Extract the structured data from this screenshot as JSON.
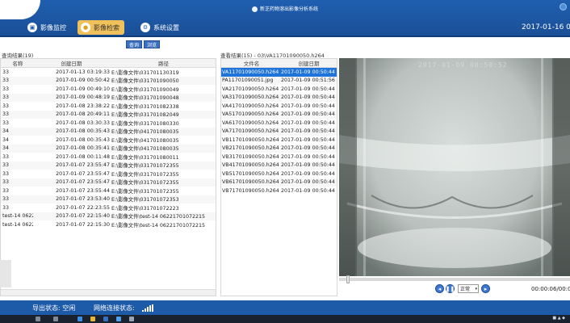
{
  "app": {
    "title": "新芝药物溶出影像分析系统",
    "datetime": "2017-01-16 0:"
  },
  "nav": {
    "tabs": [
      {
        "label": "影像监控",
        "icon": "monitor-icon"
      },
      {
        "label": "影像检索",
        "icon": "search-icon",
        "active": true
      },
      {
        "label": "系统设置",
        "icon": "gear-icon"
      }
    ]
  },
  "toolbar": {
    "query_label": "查询",
    "browse_label": "浏览"
  },
  "left_table": {
    "title": "查询结果(19)",
    "headers": [
      "名称",
      "创建日期",
      "路径"
    ],
    "rows": [
      [
        "33",
        "2017-01-13 03:19:33",
        "E:\\影像文件\\031701130319"
      ],
      [
        "33",
        "2017-01-09 00:50:42",
        "E:\\影像文件\\031701090050"
      ],
      [
        "33",
        "2017-01-09 00:49:10",
        "E:\\影像文件\\031701090049"
      ],
      [
        "33",
        "2017-01-09 00:48:19",
        "E:\\影像文件\\031701090048"
      ],
      [
        "33",
        "2017-01-08 23:38:22",
        "E:\\影像文件\\031701082338"
      ],
      [
        "33",
        "2017-01-08 20:49:11",
        "E:\\影像文件\\031701082049"
      ],
      [
        "33",
        "2017-01-08 03:30:33",
        "E:\\影像文件\\031701080330"
      ],
      [
        "34",
        "2017-01-08 00:35:43",
        "E:\\影像文件\\041701080035"
      ],
      [
        "34",
        "2017-01-08 00:35:43",
        "E:\\影像文件\\041701080035"
      ],
      [
        "34",
        "2017-01-08 00:35:41",
        "E:\\影像文件\\041701080035"
      ],
      [
        "33",
        "2017-01-08 00:11:48",
        "E:\\影像文件\\031701080011"
      ],
      [
        "33",
        "2017-01-07 23:55:47",
        "E:\\影像文件\\031701072355"
      ],
      [
        "33",
        "2017-01-07 23:55:47",
        "E:\\影像文件\\031701072355"
      ],
      [
        "33",
        "2017-01-07 23:55:47",
        "E:\\影像文件\\031701072355"
      ],
      [
        "33",
        "2017-01-07 23:55:44",
        "E:\\影像文件\\031701072355"
      ],
      [
        "33",
        "2017-01-07 23:53:40",
        "E:\\影像文件\\031701072353"
      ],
      [
        "33",
        "2017-01-07 22:23:55",
        "E:\\影像文件\\031701072223"
      ],
      [
        "test-14 0622",
        "2017-01-07 22:15:40",
        "E:\\影像文件\\test-14 06221701072215"
      ],
      [
        "test-14 0622",
        "2017-01-07 22:15:30",
        "E:\\影像文件\\test-14 06221701072215"
      ]
    ]
  },
  "mid_table": {
    "title": "查看结果(15) - 03\\VA11701090050.h264",
    "headers": [
      "文件名",
      "创建日期"
    ],
    "rows": [
      [
        "VA11701090050.h264",
        "2017-01-09 00:50:44"
      ],
      [
        "PA11701090051.jpg",
        "2017-01-09 00:51:56"
      ],
      [
        "VA21701090050.h264",
        "2017-01-09 00:50:44"
      ],
      [
        "VA31701090050.h264",
        "2017-01-09 00:50:44"
      ],
      [
        "VA41701090050.h264",
        "2017-01-09 00:50:44"
      ],
      [
        "VA51701090050.h264",
        "2017-01-09 00:50:44"
      ],
      [
        "VA61701090050.h264",
        "2017-01-09 00:50:44"
      ],
      [
        "VA71701090050.h264",
        "2017-01-09 00:50:44"
      ],
      [
        "VB11701090050.h264",
        "2017-01-09 00:50:44"
      ],
      [
        "VB21701090050.h264",
        "2017-01-09 00:50:44"
      ],
      [
        "VB31701090050.h264",
        "2017-01-09 00:50:44"
      ],
      [
        "VB41701090050.h264",
        "2017-01-09 00:50:44"
      ],
      [
        "VB51701090050.h264",
        "2017-01-09 00:50:44"
      ],
      [
        "VB61701090050.h264",
        "2017-01-09 00:50:44"
      ],
      [
        "VB71701090050.h264",
        "2017-01-09 00:50:44"
      ]
    ]
  },
  "video": {
    "overlay_timestamp": "2017-01-09 00:50:52",
    "speed_label": "正常",
    "play_time": "00:00:06/00:0",
    "progress": 0.03
  },
  "status": {
    "export_label": "导出状态: 空闲",
    "network_label": "网络连接状态:"
  },
  "colors": {
    "nav_bg": "#1b4f97",
    "active_tab": "#f0c15a",
    "selected_row": "#1e74d8",
    "status_bg": "#1d5aa8"
  }
}
